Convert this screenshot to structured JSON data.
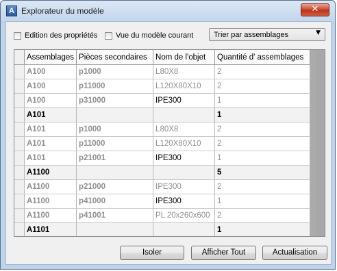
{
  "window": {
    "title": "Explorateur du modèle",
    "close_label": "✕"
  },
  "options": {
    "edit_props_label": "Edition des propriétés",
    "current_view_label": "Vue du modèle courant",
    "sort_select_value": "Trier par assemblages",
    "sort_arrow": "▼"
  },
  "grid": {
    "columns": [
      "Assemblages",
      "Pièces secondaires",
      "Nom de l'objet",
      "Quantité d' assemblages"
    ],
    "rows": [
      {
        "type": "detail",
        "asm": "A100",
        "piece": "p1000",
        "obj": "L80X8",
        "obj_dark": false,
        "qty": "2"
      },
      {
        "type": "detail",
        "asm": "A100",
        "piece": "p11000",
        "obj": "L120X80X10",
        "obj_dark": false,
        "qty": "2"
      },
      {
        "type": "detail",
        "asm": "A100",
        "piece": "p31000",
        "obj": "IPE300",
        "obj_dark": true,
        "qty": "1"
      },
      {
        "type": "summary",
        "asm": "A101",
        "piece": "",
        "obj": "",
        "obj_dark": false,
        "qty": "1"
      },
      {
        "type": "detail",
        "asm": "A101",
        "piece": "p1000",
        "obj": "L80X8",
        "obj_dark": false,
        "qty": "2"
      },
      {
        "type": "detail",
        "asm": "A101",
        "piece": "p11000",
        "obj": "L120X80X10",
        "obj_dark": false,
        "qty": "2"
      },
      {
        "type": "detail",
        "asm": "A101",
        "piece": "p21001",
        "obj": "IPE300",
        "obj_dark": true,
        "qty": "1"
      },
      {
        "type": "summary",
        "asm": "A1100",
        "piece": "",
        "obj": "",
        "obj_dark": false,
        "qty": "5"
      },
      {
        "type": "detail",
        "asm": "A1100",
        "piece": "p21000",
        "obj": "IPE300",
        "obj_dark": false,
        "qty": "2"
      },
      {
        "type": "detail",
        "asm": "A1100",
        "piece": "p41000",
        "obj": "IPE300",
        "obj_dark": true,
        "qty": "1"
      },
      {
        "type": "detail",
        "asm": "A1100",
        "piece": "p41001",
        "obj": "PL 20x260x600",
        "obj_dark": false,
        "qty": "2"
      },
      {
        "type": "summary",
        "asm": "A1101",
        "piece": "",
        "obj": "",
        "obj_dark": false,
        "qty": "1"
      }
    ]
  },
  "buttons": {
    "isolate": "Isoler",
    "show_all": "Afficher Tout",
    "refresh": "Actualisation"
  }
}
